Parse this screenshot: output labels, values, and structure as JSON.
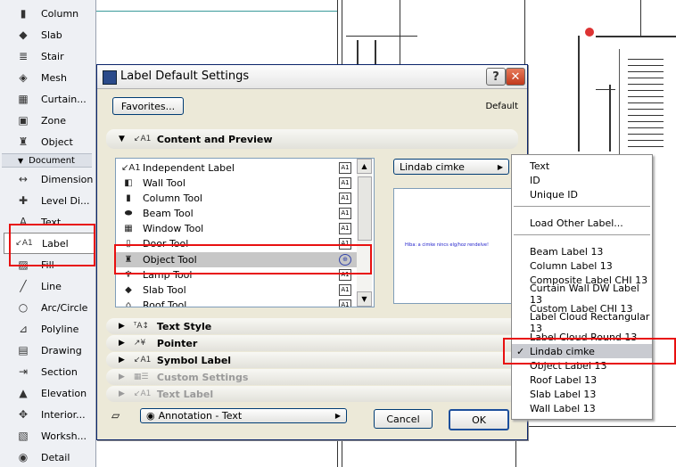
{
  "toolbox": {
    "tools": [
      {
        "label": "Column",
        "icon": "column-icon"
      },
      {
        "label": "Slab",
        "icon": "slab-icon"
      },
      {
        "label": "Stair",
        "icon": "stair-icon"
      },
      {
        "label": "Mesh",
        "icon": "mesh-icon"
      },
      {
        "label": "Curtain...",
        "icon": "curtain-wall-icon"
      },
      {
        "label": "Zone",
        "icon": "zone-icon"
      },
      {
        "label": "Object",
        "icon": "object-icon"
      }
    ],
    "document_section": "Document",
    "doc_tools": [
      {
        "label": "Dimension",
        "icon": "dimension-icon"
      },
      {
        "label": "Level Di...",
        "icon": "level-dimension-icon"
      },
      {
        "label": "Text",
        "icon": "text-icon"
      },
      {
        "label": "Label",
        "icon": "label-icon"
      },
      {
        "label": "Fill",
        "icon": "fill-icon"
      },
      {
        "label": "Line",
        "icon": "line-icon"
      },
      {
        "label": "Arc/Circle",
        "icon": "arc-circle-icon"
      },
      {
        "label": "Polyline",
        "icon": "polyline-icon"
      },
      {
        "label": "Drawing",
        "icon": "drawing-icon"
      },
      {
        "label": "Section",
        "icon": "section-icon"
      },
      {
        "label": "Elevation",
        "icon": "elevation-icon"
      },
      {
        "label": "Interior...",
        "icon": "interior-elevation-icon"
      },
      {
        "label": "Worksh...",
        "icon": "worksheet-icon"
      },
      {
        "label": "Detail",
        "icon": "detail-icon"
      }
    ]
  },
  "dialog": {
    "title": "Label Default Settings",
    "favorites_label": "Favorites...",
    "default_text": "Default",
    "content_section": "Content and Preview",
    "tool_list": [
      {
        "label": "Independent Label",
        "icon": "independent-label-icon"
      },
      {
        "label": "Wall Tool",
        "icon": "wall-icon"
      },
      {
        "label": "Column Tool",
        "icon": "column-icon"
      },
      {
        "label": "Beam Tool",
        "icon": "beam-icon"
      },
      {
        "label": "Window Tool",
        "icon": "window-icon"
      },
      {
        "label": "Door Tool",
        "icon": "door-icon"
      },
      {
        "label": "Object Tool",
        "icon": "object-icon"
      },
      {
        "label": "Lamp Tool",
        "icon": "lamp-icon"
      },
      {
        "label": "Slab Tool",
        "icon": "slab-icon"
      },
      {
        "label": "Roof Tool",
        "icon": "roof-icon"
      }
    ],
    "label_type": "Lindab cimke",
    "preview_text": "Hiba: a cimke nincs elg/hoz rendelve!",
    "text_style_section": "Text Style",
    "pointer_section": "Pointer",
    "symbol_label_section": "Symbol Label",
    "custom_settings_section": "Custom Settings",
    "text_label_section": "Text Label",
    "annotation_label": "Annotation - Text",
    "cancel_label": "Cancel",
    "ok_label": "OK"
  },
  "menu": {
    "group1": [
      "Text",
      "ID",
      "Unique ID"
    ],
    "load_other": "Load Other Label...",
    "labels": [
      "Beam Label 13",
      "Column Label 13",
      "Composite Label CHI 13",
      "Curtain Wall DW Label 13",
      "Custom Label CHI 13",
      "Label Cloud Rectangular 13",
      "Label Cloud Round 13",
      "Lindab cimke",
      "Object Label 13",
      "Roof Label 13",
      "Slab Label 13",
      "Wall Label 13"
    ],
    "checked": "Lindab cimke"
  },
  "colors": {
    "highlight": "#e81010",
    "title_close": "#c0391c",
    "selection": "#c7c7c7"
  }
}
